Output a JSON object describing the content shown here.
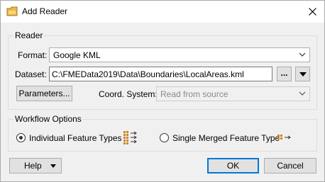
{
  "window": {
    "title": "Add Reader",
    "close_icon": "close-icon"
  },
  "reader_group": {
    "label": "Reader",
    "format_label": "Format:",
    "format_value": "Google KML",
    "dataset_label": "Dataset:",
    "dataset_value": "C:\\FMEData2019\\Data\\Boundaries\\LocalAreas.kml",
    "browse_label": "...",
    "parameters_label": "Parameters...",
    "coord_label": "Coord. System:",
    "coord_value": "Read from source"
  },
  "workflow_group": {
    "label": "Workflow Options",
    "option_individual": "Individual Feature Types",
    "option_merged": "Single Merged Feature Type",
    "selected": "individual"
  },
  "footer": {
    "help_label": "Help",
    "ok_label": "OK",
    "cancel_label": "Cancel"
  },
  "colors": {
    "accent": "#0078d7",
    "dialog_bg": "#f0f0f0",
    "icon_orange": "#c8862a"
  }
}
